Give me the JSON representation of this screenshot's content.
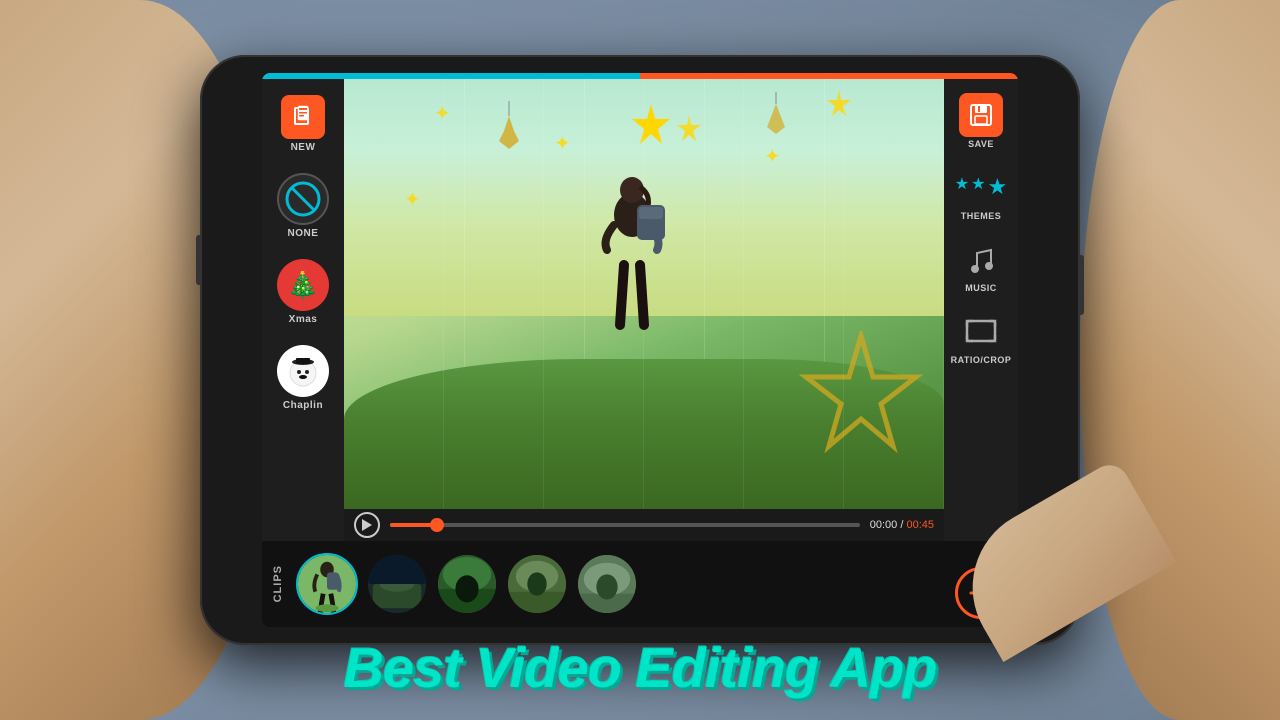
{
  "app": {
    "title": "Video Editing App"
  },
  "header": {
    "topbar_color_left": "#00bcd4",
    "topbar_color_right": "#ff5722"
  },
  "left_sidebar": {
    "new_label": "NEW",
    "none_label": "NONE",
    "xmas_label": "Xmas",
    "chaplin_label": "Chaplin"
  },
  "right_sidebar": {
    "save_label": "SAVE",
    "themes_label": "THEMES",
    "music_label": "MUSIC",
    "ratio_label": "RATIO/CROP"
  },
  "playback": {
    "time_current": "00:00",
    "time_total": "00:45",
    "progress_pct": 10
  },
  "clips": {
    "label": "CLIPS",
    "add_label": "Add",
    "items": [
      {
        "id": 1,
        "active": true
      },
      {
        "id": 2,
        "active": false
      },
      {
        "id": 3,
        "active": false
      },
      {
        "id": 4,
        "active": false
      },
      {
        "id": 5,
        "active": false
      }
    ]
  },
  "bottom_text": "Best Video Editing App",
  "icons": {
    "new": "📋",
    "none": "⊘",
    "xmas": "🎄",
    "chaplin": "🎩",
    "play": "▶",
    "plus": "+",
    "music": "♪",
    "save": "💾"
  }
}
